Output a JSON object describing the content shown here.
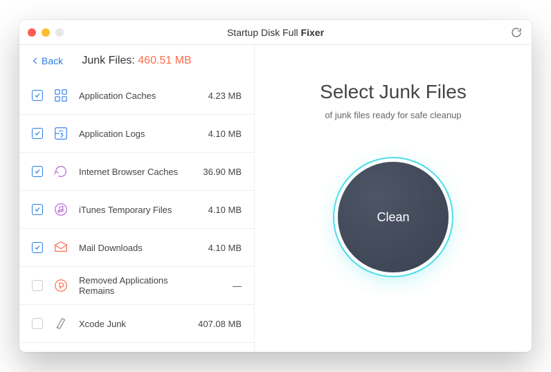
{
  "window": {
    "title_a": "Startup Disk Full ",
    "title_b": "Fixer"
  },
  "sidebar": {
    "back_label": "Back",
    "header_label": "Junk Files: ",
    "header_amount": "460.51 MB",
    "items": [
      {
        "checked": true,
        "icon": "app-caches",
        "label": "Application Caches",
        "size": "4.23 MB"
      },
      {
        "checked": true,
        "icon": "app-logs",
        "label": "Application Logs",
        "size": "4.10 MB"
      },
      {
        "checked": true,
        "icon": "browser-caches",
        "label": "Internet Browser Caches",
        "size": "36.90 MB"
      },
      {
        "checked": true,
        "icon": "itunes",
        "label": "iTunes Temporary Files",
        "size": "4.10 MB"
      },
      {
        "checked": true,
        "icon": "mail",
        "label": "Mail Downloads",
        "size": "4.10 MB"
      },
      {
        "checked": false,
        "icon": "removed",
        "label": "Removed Applications Remains",
        "size": "—"
      },
      {
        "checked": false,
        "icon": "xcode",
        "label": "Xcode Junk",
        "size": "407.08 MB"
      }
    ]
  },
  "main": {
    "title": "Select Junk Files",
    "subtitle": "of junk files ready for safe cleanup",
    "clean_label": "Clean"
  },
  "icon_colors": {
    "app-caches": "#3b82f6",
    "app-logs": "#3b82f6",
    "browser-caches": "#b866d4",
    "itunes": "#b866d4",
    "mail": "#ff6b4a",
    "removed": "#ff6b4a",
    "xcode": "#888"
  }
}
